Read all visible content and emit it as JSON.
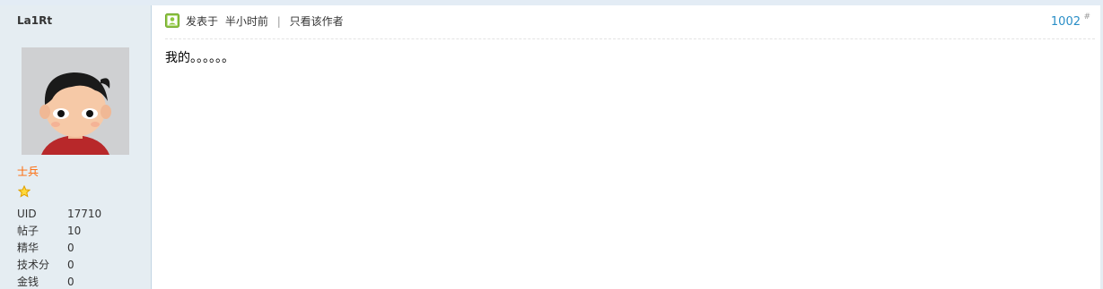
{
  "author": {
    "username": "La1Rt",
    "rank": "士兵",
    "stats": [
      {
        "label": "UID",
        "value": "17710"
      },
      {
        "label": "帖子",
        "value": "10"
      },
      {
        "label": "精华",
        "value": "0"
      },
      {
        "label": "技术分",
        "value": "0"
      },
      {
        "label": "金钱",
        "value": "0"
      }
    ]
  },
  "post": {
    "posted_prefix": "发表于",
    "posted_time": "半小时前",
    "separator": "|",
    "only_author_link": "只看该作者",
    "floor_number": "1002",
    "floor_suffix": "#",
    "content": "我的。。。。。。"
  },
  "colors": {
    "sidebar_bg": "#e5edf2",
    "rank_color": "#ff6600",
    "floor_link": "#2a8ec7"
  }
}
